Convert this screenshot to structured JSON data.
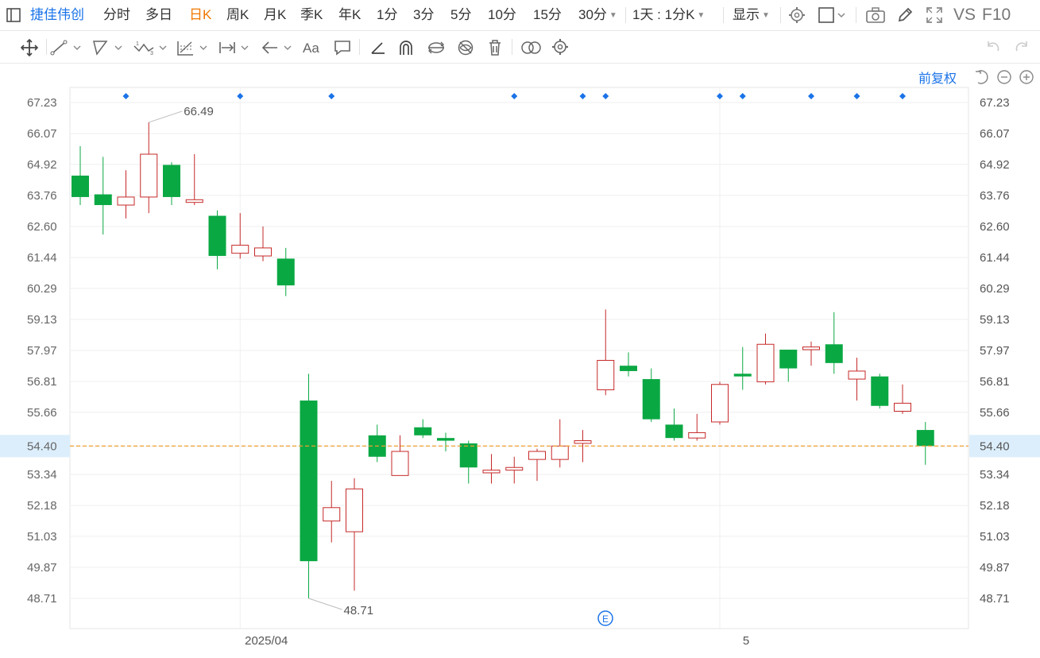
{
  "header": {
    "stock_name": "捷佳伟创",
    "tabs": [
      "分时",
      "多日",
      "日K",
      "周K",
      "月K",
      "季K",
      "年K",
      "1分",
      "3分",
      "5分",
      "10分",
      "15分",
      "30分"
    ],
    "active_tab": "日K",
    "period_select": "1天 : 1分K",
    "display_select": "显示",
    "compare_label": "VS",
    "f10_label": "F10"
  },
  "chart_controls": {
    "adjust_label": "前复权"
  },
  "colors": {
    "up": "#c62828",
    "down": "#0aa843",
    "price_line": "#f0a030",
    "marker": "#1a73e8",
    "active_tab": "#f07800"
  },
  "event_icon_letter": "E",
  "chart_data": {
    "type": "candlestick",
    "price_axis_ticks": [
      "67.23",
      "66.07",
      "64.92",
      "63.76",
      "62.60",
      "61.44",
      "60.29",
      "59.13",
      "57.97",
      "56.81",
      "55.66",
      "54.40",
      "53.34",
      "52.18",
      "51.03",
      "49.87",
      "48.71"
    ],
    "ylim": [
      48.71,
      67.23
    ],
    "x_labels": [
      {
        "index": 7,
        "label": "2025/04"
      },
      {
        "index": 28,
        "label": "5"
      }
    ],
    "current_price": 54.4,
    "max_annotation": {
      "index": 3,
      "value": "66.49"
    },
    "min_annotation": {
      "index": 10,
      "value": "48.71"
    },
    "candles": [
      {
        "o": 64.5,
        "h": 65.6,
        "l": 63.4,
        "c": 63.7
      },
      {
        "o": 63.8,
        "h": 65.2,
        "l": 62.3,
        "c": 63.4
      },
      {
        "o": 63.4,
        "h": 64.7,
        "l": 62.9,
        "c": 63.7
      },
      {
        "o": 63.7,
        "h": 66.49,
        "l": 63.1,
        "c": 65.3
      },
      {
        "o": 64.9,
        "h": 65.0,
        "l": 63.4,
        "c": 63.7
      },
      {
        "o": 63.5,
        "h": 65.3,
        "l": 63.4,
        "c": 63.6
      },
      {
        "o": 63.0,
        "h": 63.2,
        "l": 61.0,
        "c": 61.5
      },
      {
        "o": 61.6,
        "h": 63.1,
        "l": 61.4,
        "c": 61.9
      },
      {
        "o": 61.5,
        "h": 62.6,
        "l": 61.3,
        "c": 61.8
      },
      {
        "o": 61.4,
        "h": 61.8,
        "l": 60.0,
        "c": 60.4
      },
      {
        "o": 56.1,
        "h": 57.1,
        "l": 48.71,
        "c": 50.1
      },
      {
        "o": 51.6,
        "h": 53.1,
        "l": 50.8,
        "c": 52.1
      },
      {
        "o": 51.2,
        "h": 53.2,
        "l": 49.0,
        "c": 52.8
      },
      {
        "o": 54.8,
        "h": 55.2,
        "l": 53.8,
        "c": 54.0
      },
      {
        "o": 53.3,
        "h": 54.8,
        "l": 53.3,
        "c": 54.2
      },
      {
        "o": 55.1,
        "h": 55.4,
        "l": 54.7,
        "c": 54.8
      },
      {
        "o": 54.7,
        "h": 54.9,
        "l": 54.2,
        "c": 54.6
      },
      {
        "o": 54.5,
        "h": 54.6,
        "l": 53.0,
        "c": 53.6
      },
      {
        "o": 53.4,
        "h": 54.1,
        "l": 53.0,
        "c": 53.5
      },
      {
        "o": 53.5,
        "h": 54.0,
        "l": 53.0,
        "c": 53.6
      },
      {
        "o": 53.9,
        "h": 54.3,
        "l": 53.1,
        "c": 54.2
      },
      {
        "o": 53.9,
        "h": 55.4,
        "l": 53.6,
        "c": 54.4
      },
      {
        "o": 54.5,
        "h": 55.0,
        "l": 53.8,
        "c": 54.6
      },
      {
        "o": 56.5,
        "h": 59.5,
        "l": 56.3,
        "c": 57.6
      },
      {
        "o": 57.4,
        "h": 57.9,
        "l": 57.0,
        "c": 57.2
      },
      {
        "o": 56.9,
        "h": 57.3,
        "l": 55.3,
        "c": 55.4
      },
      {
        "o": 55.2,
        "h": 55.8,
        "l": 54.6,
        "c": 54.7
      },
      {
        "o": 54.7,
        "h": 55.6,
        "l": 54.6,
        "c": 54.9
      },
      {
        "o": 55.3,
        "h": 56.8,
        "l": 55.2,
        "c": 56.7
      },
      {
        "o": 57.1,
        "h": 58.1,
        "l": 56.5,
        "c": 57.0
      },
      {
        "o": 56.8,
        "h": 58.6,
        "l": 56.7,
        "c": 58.2
      },
      {
        "o": 58.0,
        "h": 58.0,
        "l": 56.8,
        "c": 57.3
      },
      {
        "o": 58.0,
        "h": 58.3,
        "l": 57.4,
        "c": 58.1
      },
      {
        "o": 58.2,
        "h": 59.4,
        "l": 57.1,
        "c": 57.5
      },
      {
        "o": 56.9,
        "h": 57.7,
        "l": 56.1,
        "c": 57.2
      },
      {
        "o": 57.0,
        "h": 57.1,
        "l": 55.8,
        "c": 55.9
      },
      {
        "o": 55.7,
        "h": 56.7,
        "l": 55.6,
        "c": 56.0
      },
      {
        "o": 55.0,
        "h": 55.3,
        "l": 53.7,
        "c": 54.4
      }
    ],
    "event_marker_indices": [
      2,
      7,
      11,
      19,
      22,
      23,
      28,
      29,
      32,
      34,
      36
    ]
  }
}
